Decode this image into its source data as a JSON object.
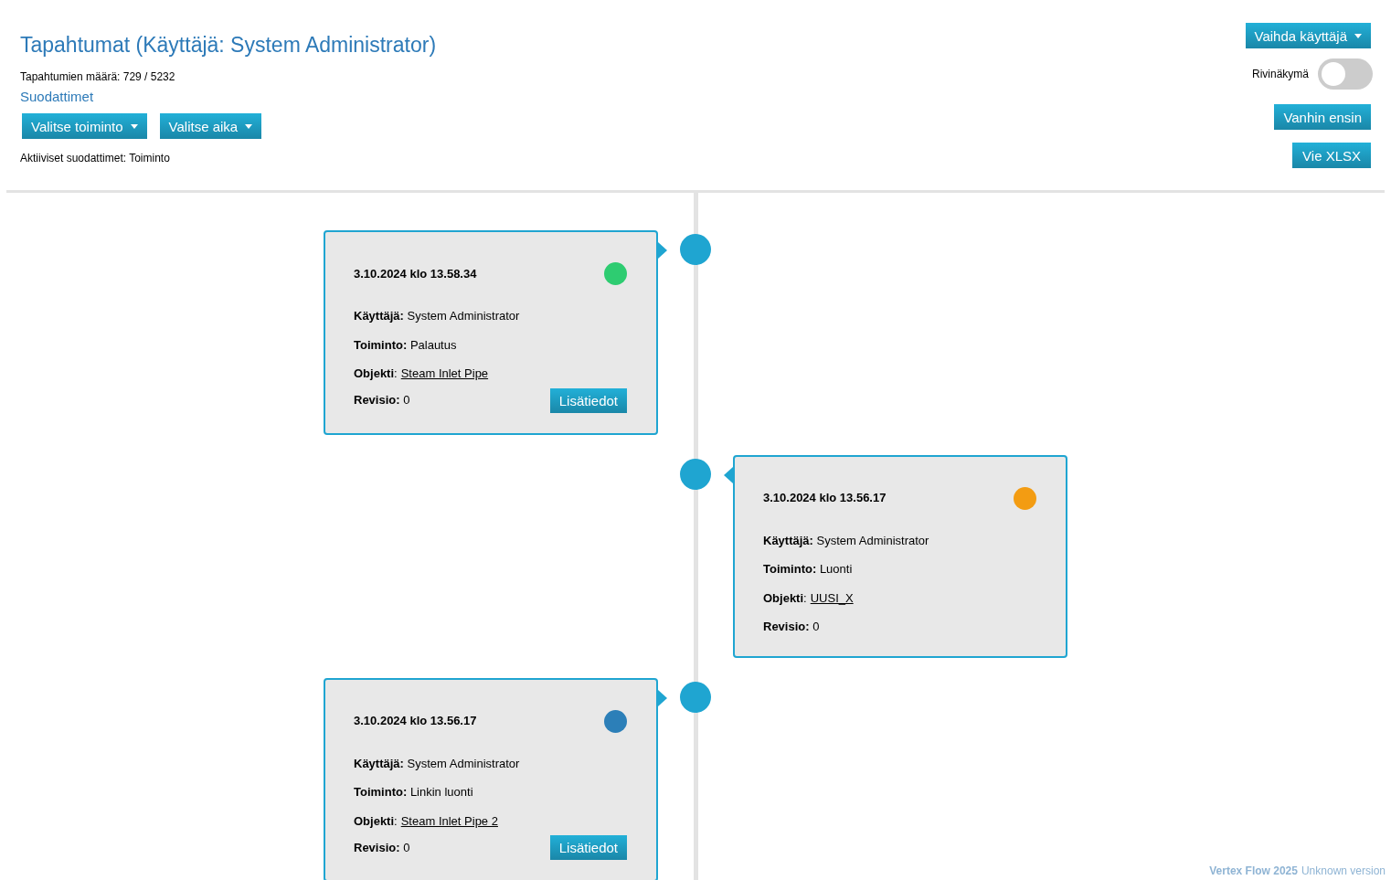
{
  "header": {
    "title": "Tapahtumat (Käyttäjä: System Administrator)",
    "count_label": "Tapahtumien määrä:",
    "count_value": "729 / 5232",
    "filters_link": "Suodattimet",
    "filter_buttons": [
      "Valitse toiminto",
      "Valitse aika"
    ],
    "active_filters": "Aktiiviset suodattimet: Toiminto"
  },
  "controls": {
    "user_button": "Vaihda käyttäjä",
    "row_view": {
      "label": "Rivinäkymä",
      "on": false
    },
    "sort_button": "Vanhin ensin",
    "export_button": "Vie XLSX"
  },
  "events": [
    {
      "timestamp": "3.10.2024 klo 13.58.34",
      "color": "#2ecc71",
      "fields": [
        {
          "label": "Käyttäjä:",
          "value": "System Administrator"
        },
        {
          "label": "Toiminto:",
          "value": "Palautus"
        },
        {
          "label": "**Objekti**:",
          "link": "Steam Inlet Pipe"
        }
      ],
      "revision_label": "Revisio:",
      "revision": "0",
      "details_button": "Lisätiedot"
    },
    {
      "timestamp": "3.10.2024 klo 13.56.17",
      "color": "#f39c12",
      "fields": [
        {
          "label": "Käyttäjä:",
          "value": "System Administrator"
        },
        {
          "label": "Toiminto:",
          "value": "Luonti"
        },
        {
          "label": "**Objekti**:",
          "link": "UUSI_X"
        }
      ],
      "revision_label": "Revisio:",
      "revision": "0"
    },
    {
      "timestamp": "3.10.2024 klo 13.56.17",
      "color": "#2c7fb8",
      "fields": [
        {
          "label": "Käyttäjä:",
          "value": "System Administrator"
        },
        {
          "label": "Toiminto:",
          "value": "Linkin luonti"
        },
        {
          "label": "**Objekti**:",
          "link": "Steam Inlet Pipe 2"
        }
      ],
      "revision_label": "Revisio:",
      "revision": "0",
      "details_button": "Lisätiedot"
    }
  ],
  "footer": {
    "brand": "Vertex Flow 2025",
    "version": "Unknown version"
  }
}
